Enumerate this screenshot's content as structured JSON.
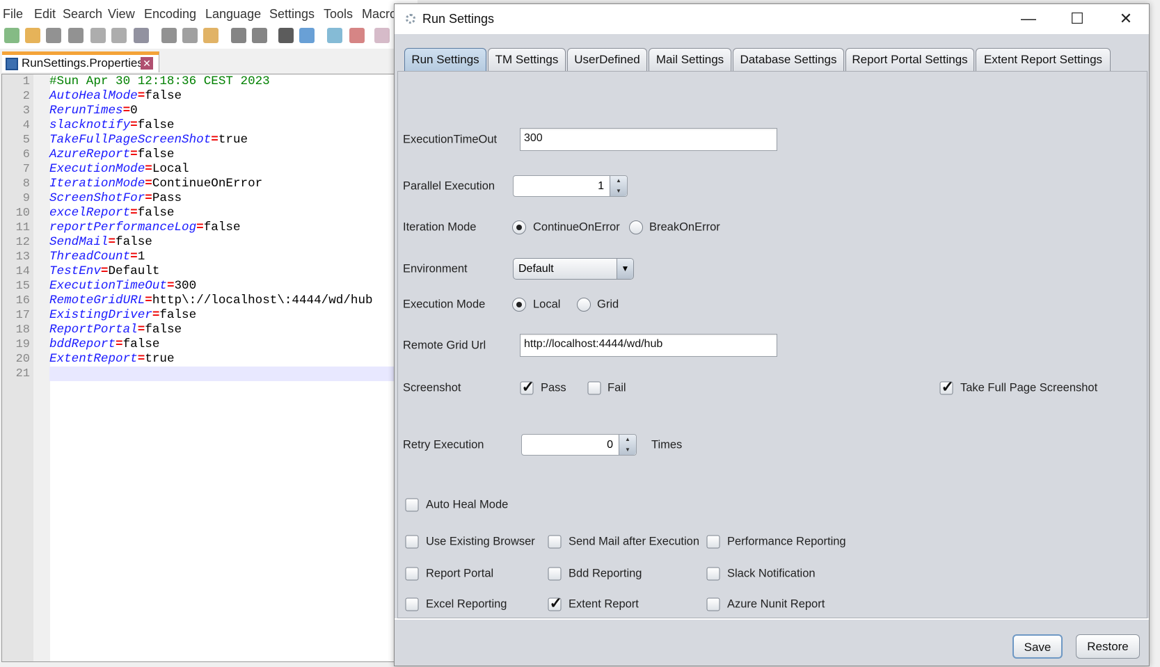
{
  "editor": {
    "menu": [
      "File",
      "Edit",
      "Search",
      "View",
      "Encoding",
      "Language",
      "Settings",
      "Tools",
      "Macro"
    ],
    "toolbar_icons": [
      "new-file-icon",
      "open-file-icon",
      "save-icon",
      "save-all-icon",
      "close-icon",
      "close-all-icon",
      "print-icon",
      "cut-icon",
      "copy-icon",
      "paste-icon",
      "undo-icon",
      "redo-icon",
      "find-icon",
      "replace-icon",
      "zoom-in-icon",
      "zoom-out-icon",
      "sync-icon"
    ],
    "tab_label": "RunSettings.Properties",
    "comment": "#Sun Apr 30 12:18:36 CEST 2023",
    "lines": [
      {
        "k": "AutoHealMode",
        "v": "false"
      },
      {
        "k": "RerunTimes",
        "v": "0"
      },
      {
        "k": "slacknotify",
        "v": "false"
      },
      {
        "k": "TakeFullPageScreenShot",
        "v": "true"
      },
      {
        "k": "AzureReport",
        "v": "false"
      },
      {
        "k": "ExecutionMode",
        "v": "Local"
      },
      {
        "k": "IterationMode",
        "v": "ContinueOnError"
      },
      {
        "k": "ScreenShotFor",
        "v": "Pass"
      },
      {
        "k": "excelReport",
        "v": "false"
      },
      {
        "k": "reportPerformanceLog",
        "v": "false"
      },
      {
        "k": "SendMail",
        "v": "false"
      },
      {
        "k": "ThreadCount",
        "v": "1"
      },
      {
        "k": "TestEnv",
        "v": "Default"
      },
      {
        "k": "ExecutionTimeOut",
        "v": "300"
      },
      {
        "k": "RemoteGridURL",
        "v": "http\\://localhost\\:4444/wd/hub"
      },
      {
        "k": "ExistingDriver",
        "v": "false"
      },
      {
        "k": "ReportPortal",
        "v": "false"
      },
      {
        "k": "bddReport",
        "v": "false"
      },
      {
        "k": "ExtentReport",
        "v": "true"
      }
    ],
    "line_count": 21
  },
  "dialog": {
    "title": "Run Settings",
    "tabs": [
      "Run Settings",
      "TM Settings",
      "UserDefined",
      "Mail Settings",
      "Database Settings",
      "Report Portal Settings",
      "Extent Report Settings"
    ],
    "active_tab": "Run Settings",
    "execution_timeout": {
      "label": "ExecutionTimeOut",
      "value": "300"
    },
    "parallel_execution": {
      "label": "Parallel Execution",
      "value": "1"
    },
    "iteration_mode": {
      "label": "Iteration Mode",
      "options": [
        "ContinueOnError",
        "BreakOnError"
      ],
      "selected": "ContinueOnError"
    },
    "environment": {
      "label": "Environment",
      "value": "Default"
    },
    "execution_mode": {
      "label": "Execution Mode",
      "options": [
        "Local",
        "Grid"
      ],
      "selected": "Local"
    },
    "remote_grid_url": {
      "label": "Remote Grid Url",
      "value": "http://localhost:4444/wd/hub"
    },
    "screenshot": {
      "label": "Screenshot",
      "pass": "Pass",
      "pass_checked": true,
      "fail": "Fail",
      "fail_checked": false,
      "full_page": "Take Full Page Screenshot",
      "full_page_checked": true
    },
    "retry": {
      "label": "Retry Execution",
      "value": "0",
      "unit": "Times"
    },
    "checkboxes": [
      {
        "label": "Auto Heal Mode",
        "checked": false
      },
      {
        "label": "Use Existing Browser",
        "checked": false
      },
      {
        "label": "Send Mail after Execution",
        "checked": false
      },
      {
        "label": "Performance Reporting",
        "checked": false
      },
      {
        "label": "Report Portal",
        "checked": false
      },
      {
        "label": "Bdd Reporting",
        "checked": false
      },
      {
        "label": "Slack Notification",
        "checked": false
      },
      {
        "label": "Excel Reporting",
        "checked": false
      },
      {
        "label": "Extent Report",
        "checked": true
      },
      {
        "label": "Azure Nunit Report",
        "checked": false
      }
    ],
    "save_label": "Save",
    "restore_label": "Restore"
  }
}
